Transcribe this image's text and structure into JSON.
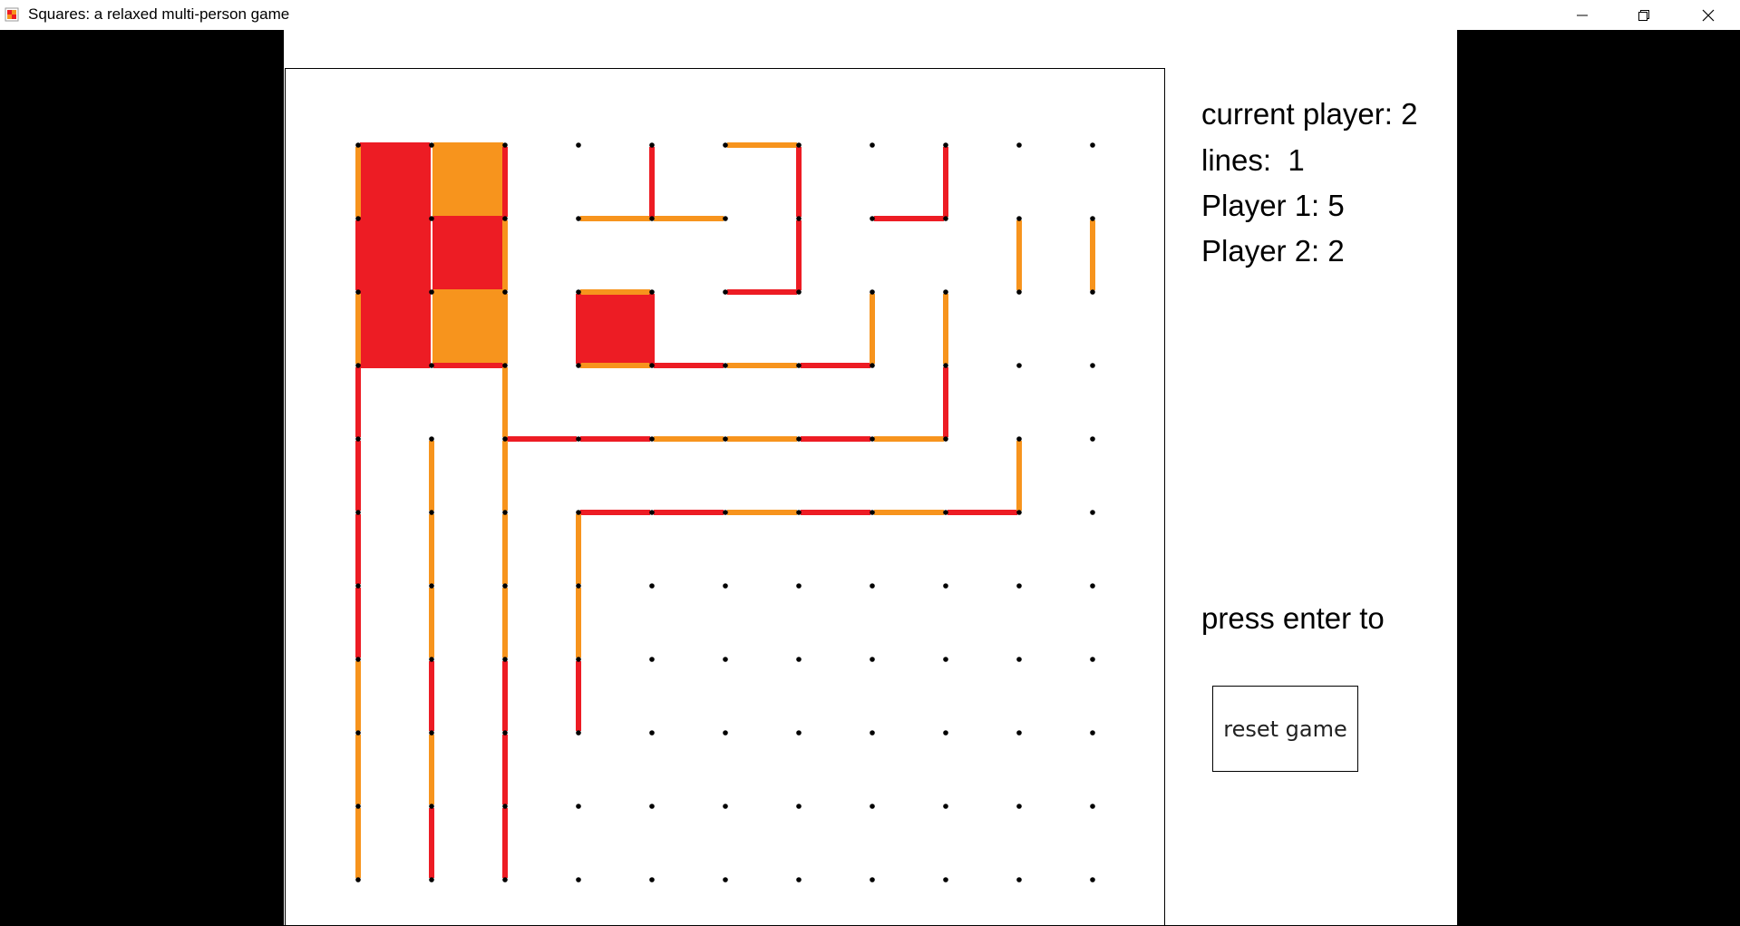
{
  "window": {
    "title": "Squares: a relaxed multi-person game"
  },
  "status": {
    "current_player": "current player: 2",
    "lines": "lines:  1",
    "player1": "Player 1: 5",
    "player2": "Player 2: 2",
    "prompt": "press enter to"
  },
  "buttons": {
    "reset": "reset game"
  },
  "colors": {
    "player1": "#ed1c24",
    "player2": "#f7941d",
    "dot": "#000000"
  },
  "icons": {
    "app": "squares-app-icon",
    "minimize": "minimize-icon",
    "maximize": "restore-icon",
    "close": "close-icon"
  },
  "game": {
    "grid_cols": 11,
    "grid_rows": 11,
    "horizontal_lines": [
      {
        "r": 0,
        "c": 0,
        "p": 1
      },
      {
        "r": 0,
        "c": 1,
        "p": 2
      },
      {
        "r": 0,
        "c": 5,
        "p": 2
      },
      {
        "r": 1,
        "c": 0,
        "p": 1
      },
      {
        "r": 1,
        "c": 1,
        "p": 1
      },
      {
        "r": 1,
        "c": 3,
        "p": 2
      },
      {
        "r": 1,
        "c": 4,
        "p": 2
      },
      {
        "r": 1,
        "c": 7,
        "p": 1
      },
      {
        "r": 2,
        "c": 0,
        "p": 1
      },
      {
        "r": 2,
        "c": 1,
        "p": 2
      },
      {
        "r": 2,
        "c": 3,
        "p": 2
      },
      {
        "r": 2,
        "c": 5,
        "p": 1
      },
      {
        "r": 3,
        "c": 0,
        "p": 1
      },
      {
        "r": 3,
        "c": 1,
        "p": 1
      },
      {
        "r": 3,
        "c": 3,
        "p": 2
      },
      {
        "r": 3,
        "c": 4,
        "p": 1
      },
      {
        "r": 3,
        "c": 5,
        "p": 2
      },
      {
        "r": 3,
        "c": 6,
        "p": 1
      },
      {
        "r": 4,
        "c": 2,
        "p": 1
      },
      {
        "r": 4,
        "c": 3,
        "p": 1
      },
      {
        "r": 4,
        "c": 4,
        "p": 2
      },
      {
        "r": 4,
        "c": 5,
        "p": 2
      },
      {
        "r": 4,
        "c": 6,
        "p": 1
      },
      {
        "r": 4,
        "c": 7,
        "p": 2
      },
      {
        "r": 5,
        "c": 3,
        "p": 1
      },
      {
        "r": 5,
        "c": 4,
        "p": 1
      },
      {
        "r": 5,
        "c": 5,
        "p": 2
      },
      {
        "r": 5,
        "c": 6,
        "p": 1
      },
      {
        "r": 5,
        "c": 7,
        "p": 2
      },
      {
        "r": 5,
        "c": 8,
        "p": 1
      }
    ],
    "vertical_lines": [
      {
        "r": 0,
        "c": 0,
        "p": 2
      },
      {
        "r": 0,
        "c": 2,
        "p": 1
      },
      {
        "r": 0,
        "c": 4,
        "p": 1
      },
      {
        "r": 0,
        "c": 6,
        "p": 1
      },
      {
        "r": 0,
        "c": 8,
        "p": 1
      },
      {
        "r": 1,
        "c": 0,
        "p": 1
      },
      {
        "r": 1,
        "c": 2,
        "p": 2
      },
      {
        "r": 1,
        "c": 6,
        "p": 1
      },
      {
        "r": 1,
        "c": 9,
        "p": 2
      },
      {
        "r": 1,
        "c": 10,
        "p": 2
      },
      {
        "r": 2,
        "c": 0,
        "p": 2
      },
      {
        "r": 2,
        "c": 2,
        "p": 2
      },
      {
        "r": 2,
        "c": 3,
        "p": 1
      },
      {
        "r": 2,
        "c": 4,
        "p": 1
      },
      {
        "r": 2,
        "c": 7,
        "p": 2
      },
      {
        "r": 2,
        "c": 8,
        "p": 2
      },
      {
        "r": 3,
        "c": 0,
        "p": 1
      },
      {
        "r": 3,
        "c": 2,
        "p": 2
      },
      {
        "r": 3,
        "c": 8,
        "p": 1
      },
      {
        "r": 4,
        "c": 0,
        "p": 1
      },
      {
        "r": 4,
        "c": 1,
        "p": 2
      },
      {
        "r": 4,
        "c": 2,
        "p": 2
      },
      {
        "r": 4,
        "c": 9,
        "p": 2
      },
      {
        "r": 5,
        "c": 0,
        "p": 1
      },
      {
        "r": 5,
        "c": 1,
        "p": 2
      },
      {
        "r": 5,
        "c": 2,
        "p": 2
      },
      {
        "r": 5,
        "c": 3,
        "p": 2
      },
      {
        "r": 6,
        "c": 0,
        "p": 1
      },
      {
        "r": 6,
        "c": 1,
        "p": 2
      },
      {
        "r": 6,
        "c": 2,
        "p": 2
      },
      {
        "r": 6,
        "c": 3,
        "p": 2
      },
      {
        "r": 7,
        "c": 0,
        "p": 2
      },
      {
        "r": 7,
        "c": 1,
        "p": 1
      },
      {
        "r": 7,
        "c": 2,
        "p": 1
      },
      {
        "r": 7,
        "c": 3,
        "p": 1
      },
      {
        "r": 8,
        "c": 0,
        "p": 2
      },
      {
        "r": 8,
        "c": 1,
        "p": 2
      },
      {
        "r": 8,
        "c": 2,
        "p": 1
      },
      {
        "r": 9,
        "c": 0,
        "p": 2
      },
      {
        "r": 9,
        "c": 1,
        "p": 1
      },
      {
        "r": 9,
        "c": 2,
        "p": 1
      }
    ],
    "filled_squares": [
      {
        "r": 0,
        "c": 0,
        "p": 1
      },
      {
        "r": 0,
        "c": 1,
        "p": 2
      },
      {
        "r": 1,
        "c": 0,
        "p": 1
      },
      {
        "r": 1,
        "c": 1,
        "p": 1
      },
      {
        "r": 2,
        "c": 0,
        "p": 1
      },
      {
        "r": 2,
        "c": 1,
        "p": 2
      },
      {
        "r": 2,
        "c": 3,
        "p": 1
      }
    ]
  }
}
